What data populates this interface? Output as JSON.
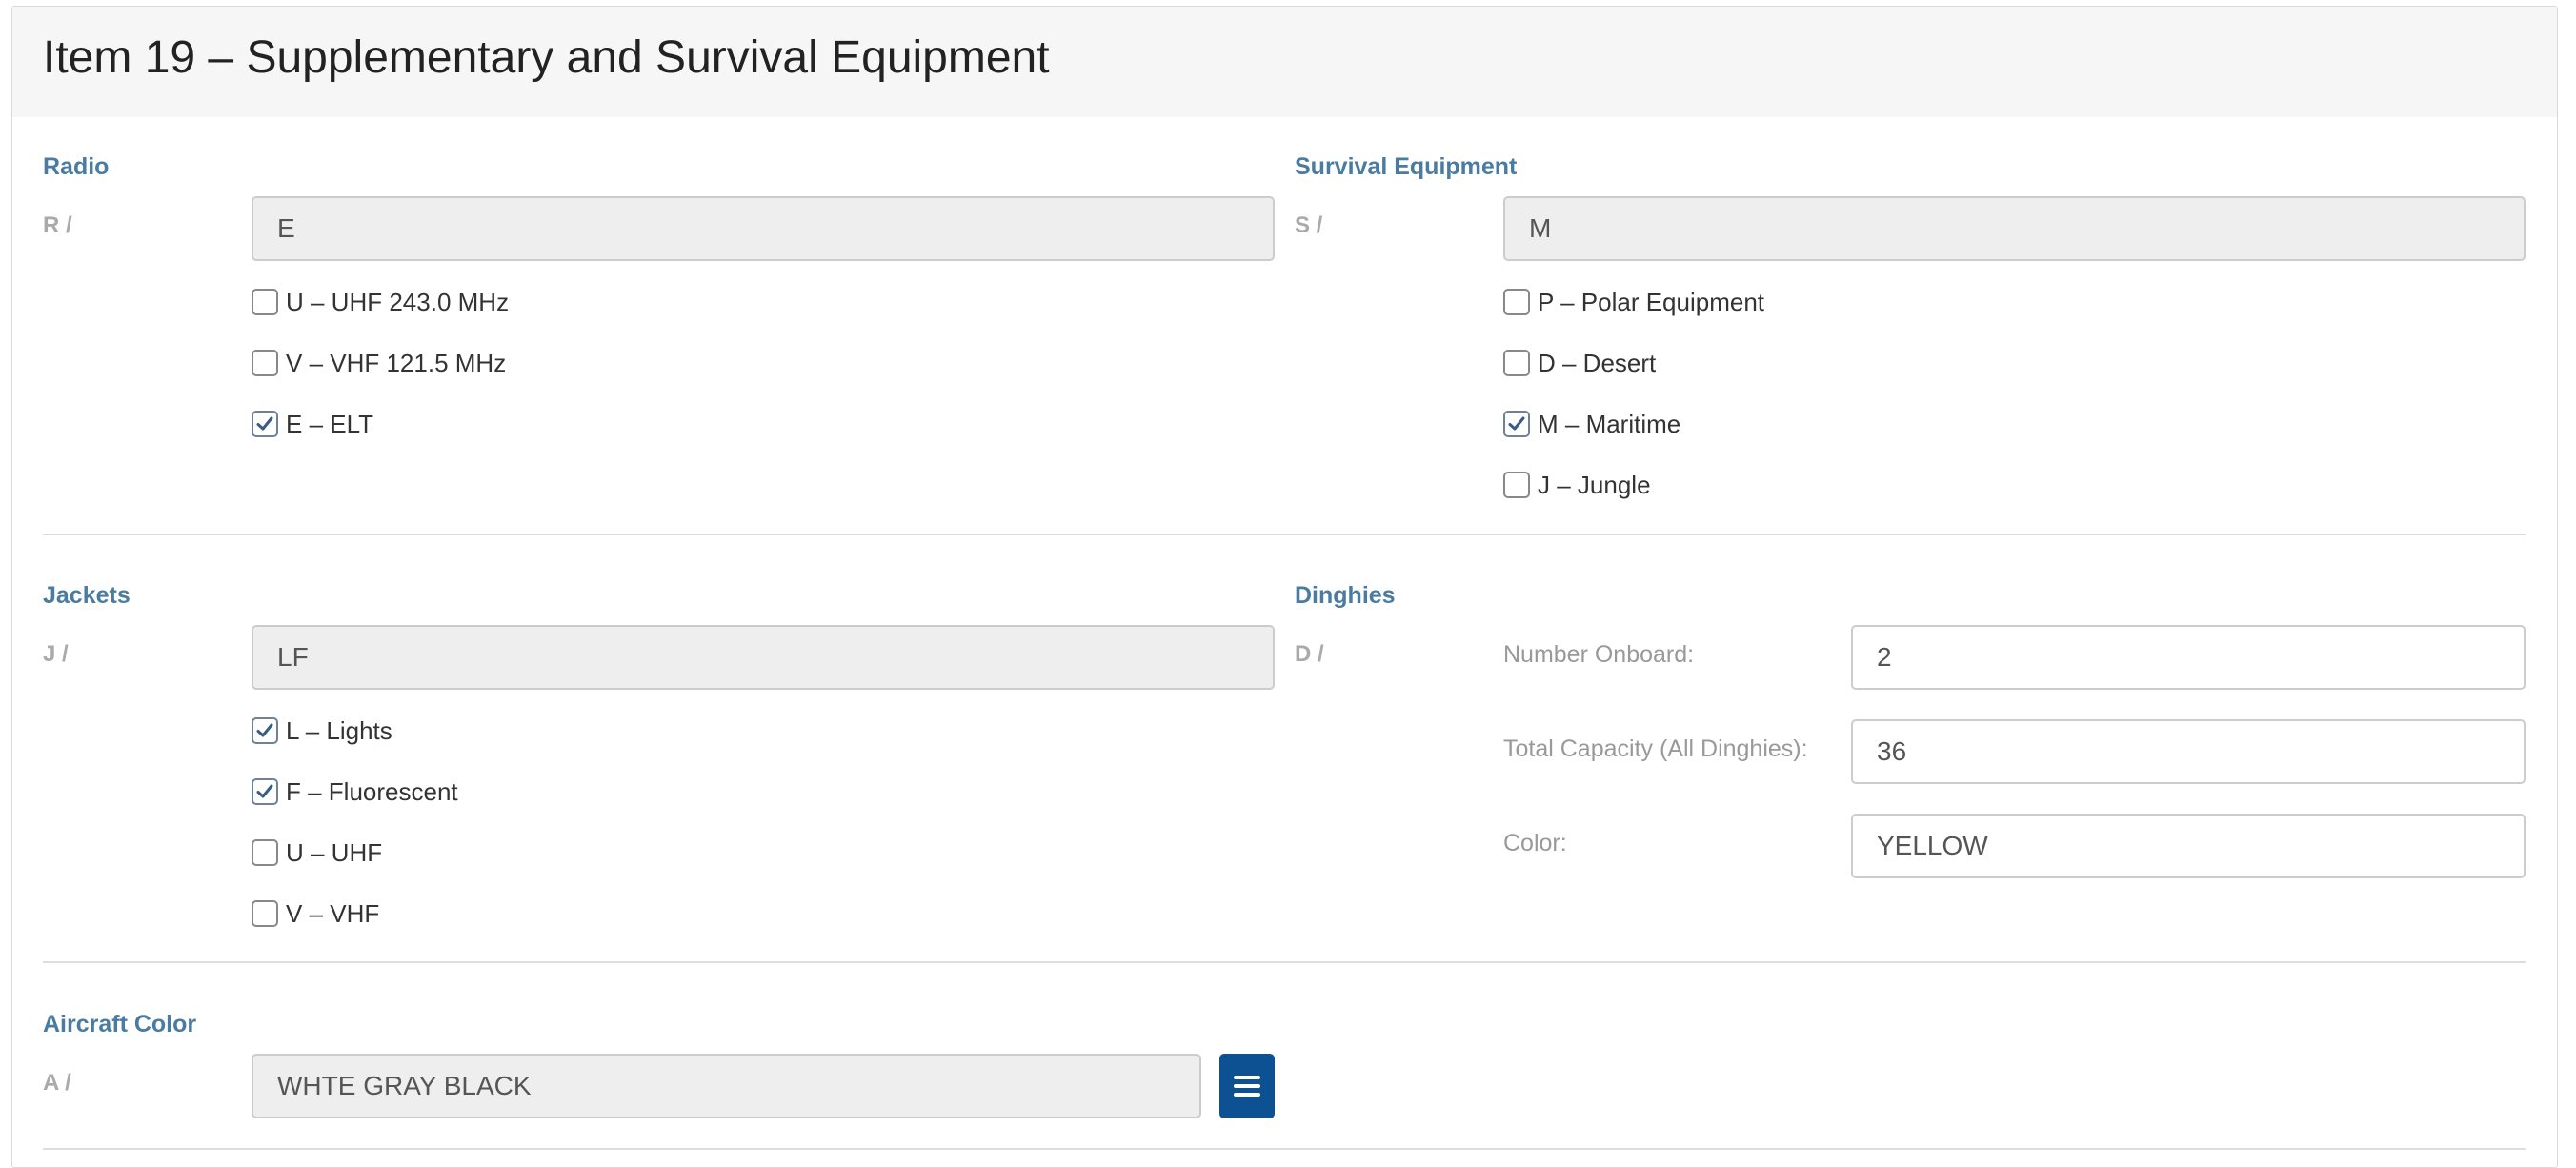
{
  "title": "Item 19 – Supplementary and Survival Equipment",
  "radio": {
    "title": "Radio",
    "prefix": "R /",
    "value": "E",
    "options": [
      {
        "label": "U – UHF 243.0 MHz",
        "checked": false
      },
      {
        "label": "V – VHF 121.5 MHz",
        "checked": false
      },
      {
        "label": "E – ELT",
        "checked": true
      }
    ]
  },
  "survival": {
    "title": "Survival Equipment",
    "prefix": "S /",
    "value": "M",
    "options": [
      {
        "label": "P – Polar Equipment",
        "checked": false
      },
      {
        "label": "D – Desert",
        "checked": false
      },
      {
        "label": "M – Maritime",
        "checked": true
      },
      {
        "label": "J – Jungle",
        "checked": false
      }
    ]
  },
  "jackets": {
    "title": "Jackets",
    "prefix": "J /",
    "value": "LF",
    "options": [
      {
        "label": "L – Lights",
        "checked": true
      },
      {
        "label": "F – Fluorescent",
        "checked": true
      },
      {
        "label": "U – UHF",
        "checked": false
      },
      {
        "label": "V – VHF",
        "checked": false
      }
    ]
  },
  "dinghies": {
    "title": "Dinghies",
    "prefix": "D /",
    "number_label": "Number Onboard:",
    "number_value": "2",
    "capacity_label": "Total Capacity (All Dinghies):",
    "capacity_value": "36",
    "color_label": "Color:",
    "color_value": "YELLOW"
  },
  "aircraft_color": {
    "title": "Aircraft Color",
    "prefix": "A /",
    "value": "WHTE GRAY BLACK",
    "menu_icon": "bars-icon"
  },
  "colors": {
    "section_title": "#4a7ba1",
    "button": "#0d5192",
    "readonly_bg": "#eeeeee"
  }
}
